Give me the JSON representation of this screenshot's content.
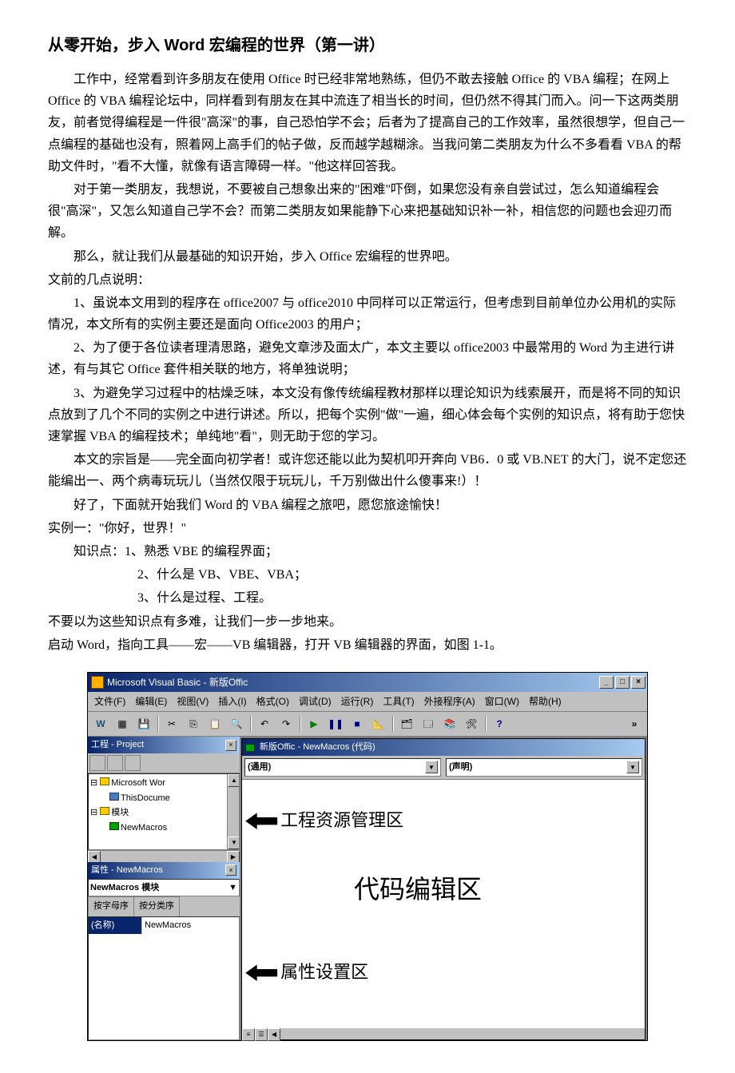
{
  "title": "从零开始，步入 Word 宏编程的世界（第一讲）",
  "paragraphs": [
    "工作中，经常看到许多朋友在使用 Office 时已经非常地熟练，但仍不敢去接触 Office 的 VBA 编程；在网上 Office 的 VBA 编程论坛中，同样看到有朋友在其中流连了相当长的时间，但仍然不得其门而入。问一下这两类朋友，前者觉得编程是一件很\"高深\"的事，自己恐怕学不会；后者为了提高自己的工作效率，虽然很想学，但自己一点编程的基础也没有，照着网上高手们的帖子做，反而越学越糊涂。当我问第二类朋友为什么不多看看 VBA 的帮助文件时，\"看不大懂，就像有语言障碍一样。\"他这样回答我。",
    "对于第一类朋友，我想说，不要被自己想象出来的\"困难\"吓倒，如果您没有亲自尝试过，怎么知道编程会很\"高深\"，又怎么知道自己学不会？而第二类朋友如果能静下心来把基础知识补一补，相信您的问题也会迎刃而解。",
    "那么，就让我们从最基础的知识开始，步入 Office 宏编程的世界吧。"
  ],
  "preface_label": "文前的几点说明：",
  "notes": [
    "1、虽说本文用到的程序在 office2007 与 office2010 中同样可以正常运行，但考虑到目前单位办公用机的实际情况，本文所有的实例主要还是面向 Office2003 的用户；",
    "2、为了便于各位读者理清思路，避免文章涉及面太广，本文主要以 office2003 中最常用的 Word 为主进行讲述，有与其它 Office 套件相关联的地方，将单独说明；",
    "3、为避免学习过程中的枯燥乏味，本文没有像传统编程教材那样以理论知识为线索展开，而是将不同的知识点放到了几个不同的实例之中进行讲述。所以，把每个实例\"做\"一遍，细心体会每个实例的知识点，将有助于您快速掌握 VBA 的编程技术；单纯地\"看\"，则无助于您的学习。"
  ],
  "purpose": "本文的宗旨是——完全面向初学者！或许您还能以此为契机叩开奔向 VB6．0 或 VB.NET 的大门，说不定您还能编出一、两个病毒玩玩儿（当然仅限于玩玩儿，千万别做出什么傻事来!）！",
  "wish": "好了，下面就开始我们 Word 的 VBA 编程之旅吧，愿您旅途愉快！",
  "example": {
    "label": "实例一：\"你好，世界！\"",
    "points_label": "知识点：",
    "points": [
      "1、熟悉 VBE 的编程界面；",
      "2、什么是 VB、VBE、VBA；",
      "3、什么是过程、工程。"
    ]
  },
  "nohard": "不要以为这些知识点有多难，让我们一步一步地来。",
  "launch": "启动 Word，指向工具——宏——VB 编辑器，打开 VB 编辑器的界面，如图 1-1。",
  "vbe": {
    "title": "Microsoft Visual Basic - 新版Offic",
    "menus": [
      "文件(F)",
      "编辑(E)",
      "视图(V)",
      "插入(I)",
      "格式(O)",
      "调试(D)",
      "运行(R)",
      "工具(T)",
      "外接程序(A)",
      "窗口(W)",
      "帮助(H)"
    ],
    "project_pane": "工程 - Project",
    "tree": {
      "root": "Microsoft Wor",
      "doc": "ThisDocume",
      "mod_folder": "模块",
      "mod": "NewMacros"
    },
    "props_pane": "属性 - NewMacros",
    "props_obj": "NewMacros 模块",
    "tabs": [
      "按字母序",
      "按分类序"
    ],
    "prop_name": "(名称)",
    "prop_val": "NewMacros",
    "code_title": "新版Offic - NewMacros (代码)",
    "combo_left": "(通用)",
    "combo_right": "(声明)",
    "annot_project": "工程资源管理区",
    "annot_code": "代码编辑区",
    "annot_props": "属性设置区"
  }
}
